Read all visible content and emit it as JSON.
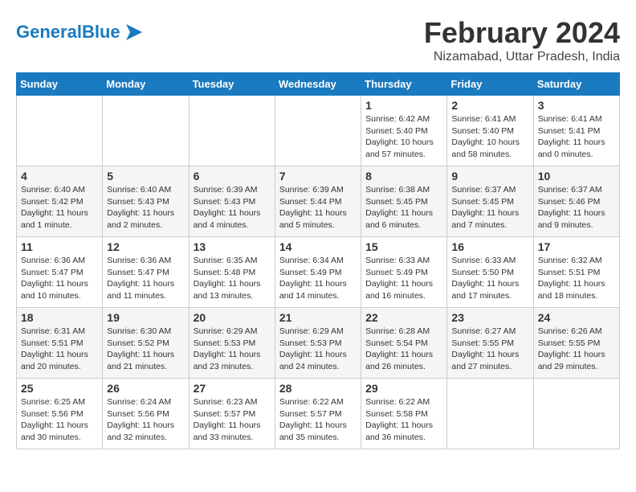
{
  "header": {
    "logo_general": "General",
    "logo_blue": "Blue",
    "month_year": "February 2024",
    "location": "Nizamabad, Uttar Pradesh, India"
  },
  "days_of_week": [
    "Sunday",
    "Monday",
    "Tuesday",
    "Wednesday",
    "Thursday",
    "Friday",
    "Saturday"
  ],
  "weeks": [
    [
      {
        "day": "",
        "info": ""
      },
      {
        "day": "",
        "info": ""
      },
      {
        "day": "",
        "info": ""
      },
      {
        "day": "",
        "info": ""
      },
      {
        "day": "1",
        "info": "Sunrise: 6:42 AM\nSunset: 5:40 PM\nDaylight: 10 hours\nand 57 minutes."
      },
      {
        "day": "2",
        "info": "Sunrise: 6:41 AM\nSunset: 5:40 PM\nDaylight: 10 hours\nand 58 minutes."
      },
      {
        "day": "3",
        "info": "Sunrise: 6:41 AM\nSunset: 5:41 PM\nDaylight: 11 hours\nand 0 minutes."
      }
    ],
    [
      {
        "day": "4",
        "info": "Sunrise: 6:40 AM\nSunset: 5:42 PM\nDaylight: 11 hours\nand 1 minute."
      },
      {
        "day": "5",
        "info": "Sunrise: 6:40 AM\nSunset: 5:43 PM\nDaylight: 11 hours\nand 2 minutes."
      },
      {
        "day": "6",
        "info": "Sunrise: 6:39 AM\nSunset: 5:43 PM\nDaylight: 11 hours\nand 4 minutes."
      },
      {
        "day": "7",
        "info": "Sunrise: 6:39 AM\nSunset: 5:44 PM\nDaylight: 11 hours\nand 5 minutes."
      },
      {
        "day": "8",
        "info": "Sunrise: 6:38 AM\nSunset: 5:45 PM\nDaylight: 11 hours\nand 6 minutes."
      },
      {
        "day": "9",
        "info": "Sunrise: 6:37 AM\nSunset: 5:45 PM\nDaylight: 11 hours\nand 7 minutes."
      },
      {
        "day": "10",
        "info": "Sunrise: 6:37 AM\nSunset: 5:46 PM\nDaylight: 11 hours\nand 9 minutes."
      }
    ],
    [
      {
        "day": "11",
        "info": "Sunrise: 6:36 AM\nSunset: 5:47 PM\nDaylight: 11 hours\nand 10 minutes."
      },
      {
        "day": "12",
        "info": "Sunrise: 6:36 AM\nSunset: 5:47 PM\nDaylight: 11 hours\nand 11 minutes."
      },
      {
        "day": "13",
        "info": "Sunrise: 6:35 AM\nSunset: 5:48 PM\nDaylight: 11 hours\nand 13 minutes."
      },
      {
        "day": "14",
        "info": "Sunrise: 6:34 AM\nSunset: 5:49 PM\nDaylight: 11 hours\nand 14 minutes."
      },
      {
        "day": "15",
        "info": "Sunrise: 6:33 AM\nSunset: 5:49 PM\nDaylight: 11 hours\nand 16 minutes."
      },
      {
        "day": "16",
        "info": "Sunrise: 6:33 AM\nSunset: 5:50 PM\nDaylight: 11 hours\nand 17 minutes."
      },
      {
        "day": "17",
        "info": "Sunrise: 6:32 AM\nSunset: 5:51 PM\nDaylight: 11 hours\nand 18 minutes."
      }
    ],
    [
      {
        "day": "18",
        "info": "Sunrise: 6:31 AM\nSunset: 5:51 PM\nDaylight: 11 hours\nand 20 minutes."
      },
      {
        "day": "19",
        "info": "Sunrise: 6:30 AM\nSunset: 5:52 PM\nDaylight: 11 hours\nand 21 minutes."
      },
      {
        "day": "20",
        "info": "Sunrise: 6:29 AM\nSunset: 5:53 PM\nDaylight: 11 hours\nand 23 minutes."
      },
      {
        "day": "21",
        "info": "Sunrise: 6:29 AM\nSunset: 5:53 PM\nDaylight: 11 hours\nand 24 minutes."
      },
      {
        "day": "22",
        "info": "Sunrise: 6:28 AM\nSunset: 5:54 PM\nDaylight: 11 hours\nand 26 minutes."
      },
      {
        "day": "23",
        "info": "Sunrise: 6:27 AM\nSunset: 5:55 PM\nDaylight: 11 hours\nand 27 minutes."
      },
      {
        "day": "24",
        "info": "Sunrise: 6:26 AM\nSunset: 5:55 PM\nDaylight: 11 hours\nand 29 minutes."
      }
    ],
    [
      {
        "day": "25",
        "info": "Sunrise: 6:25 AM\nSunset: 5:56 PM\nDaylight: 11 hours\nand 30 minutes."
      },
      {
        "day": "26",
        "info": "Sunrise: 6:24 AM\nSunset: 5:56 PM\nDaylight: 11 hours\nand 32 minutes."
      },
      {
        "day": "27",
        "info": "Sunrise: 6:23 AM\nSunset: 5:57 PM\nDaylight: 11 hours\nand 33 minutes."
      },
      {
        "day": "28",
        "info": "Sunrise: 6:22 AM\nSunset: 5:57 PM\nDaylight: 11 hours\nand 35 minutes."
      },
      {
        "day": "29",
        "info": "Sunrise: 6:22 AM\nSunset: 5:58 PM\nDaylight: 11 hours\nand 36 minutes."
      },
      {
        "day": "",
        "info": ""
      },
      {
        "day": "",
        "info": ""
      }
    ]
  ]
}
